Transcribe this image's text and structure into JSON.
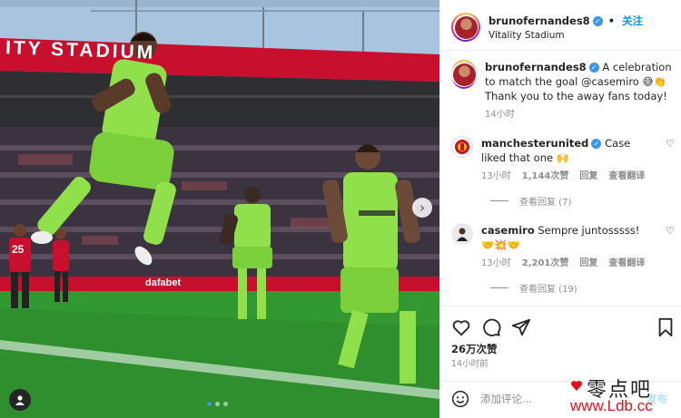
{
  "post": {
    "photo": {
      "stadium_sign_text": "ITY STADIUM",
      "ad_board_text": "dafabet",
      "player_numbers": [
        "25"
      ],
      "carousel": {
        "total": 3,
        "active_index": 0
      }
    },
    "header": {
      "username": "brunofernandes8",
      "separator": "•",
      "follow_label": "关注",
      "location": "Vitality Stadium"
    },
    "caption": {
      "username": "brunofernandes8",
      "text": "A celebration to match the goal @casemiro 😅👏 Thank you to the away fans today!",
      "time": "14小时"
    },
    "comments": [
      {
        "username": "manchesterunited",
        "text": "Case liked that one 🙌",
        "time": "13小时",
        "likes": "1,144次赞",
        "reply_label": "回复",
        "translate_label": "查看翻译",
        "view_replies": "查看回复 (7)"
      },
      {
        "username": "casemiro",
        "text": "Sempre juntosssss! 🤝💥🤝",
        "time": "13小时",
        "likes": "2,201次赞",
        "reply_label": "回复",
        "translate_label": "查看翻译",
        "view_replies": "查看回复 (19)"
      }
    ],
    "actions": {
      "like_icon": "heart-icon",
      "comment_icon": "comment-icon",
      "share_icon": "share-icon",
      "save_icon": "bookmark-icon"
    },
    "likes_count": "26万次赞",
    "post_time": "14小时前",
    "add_comment": {
      "placeholder": "添加评论...",
      "emoji_icon": "emoji-icon",
      "post_label": "发布"
    }
  },
  "watermark": {
    "chinese": "零点吧",
    "url": "www.Ldb.cc"
  },
  "colors": {
    "kit_green": "#8fe04a",
    "follow_blue": "#0095f6",
    "pitch": "#2f8f2f",
    "stadium_red": "#c8102e"
  }
}
